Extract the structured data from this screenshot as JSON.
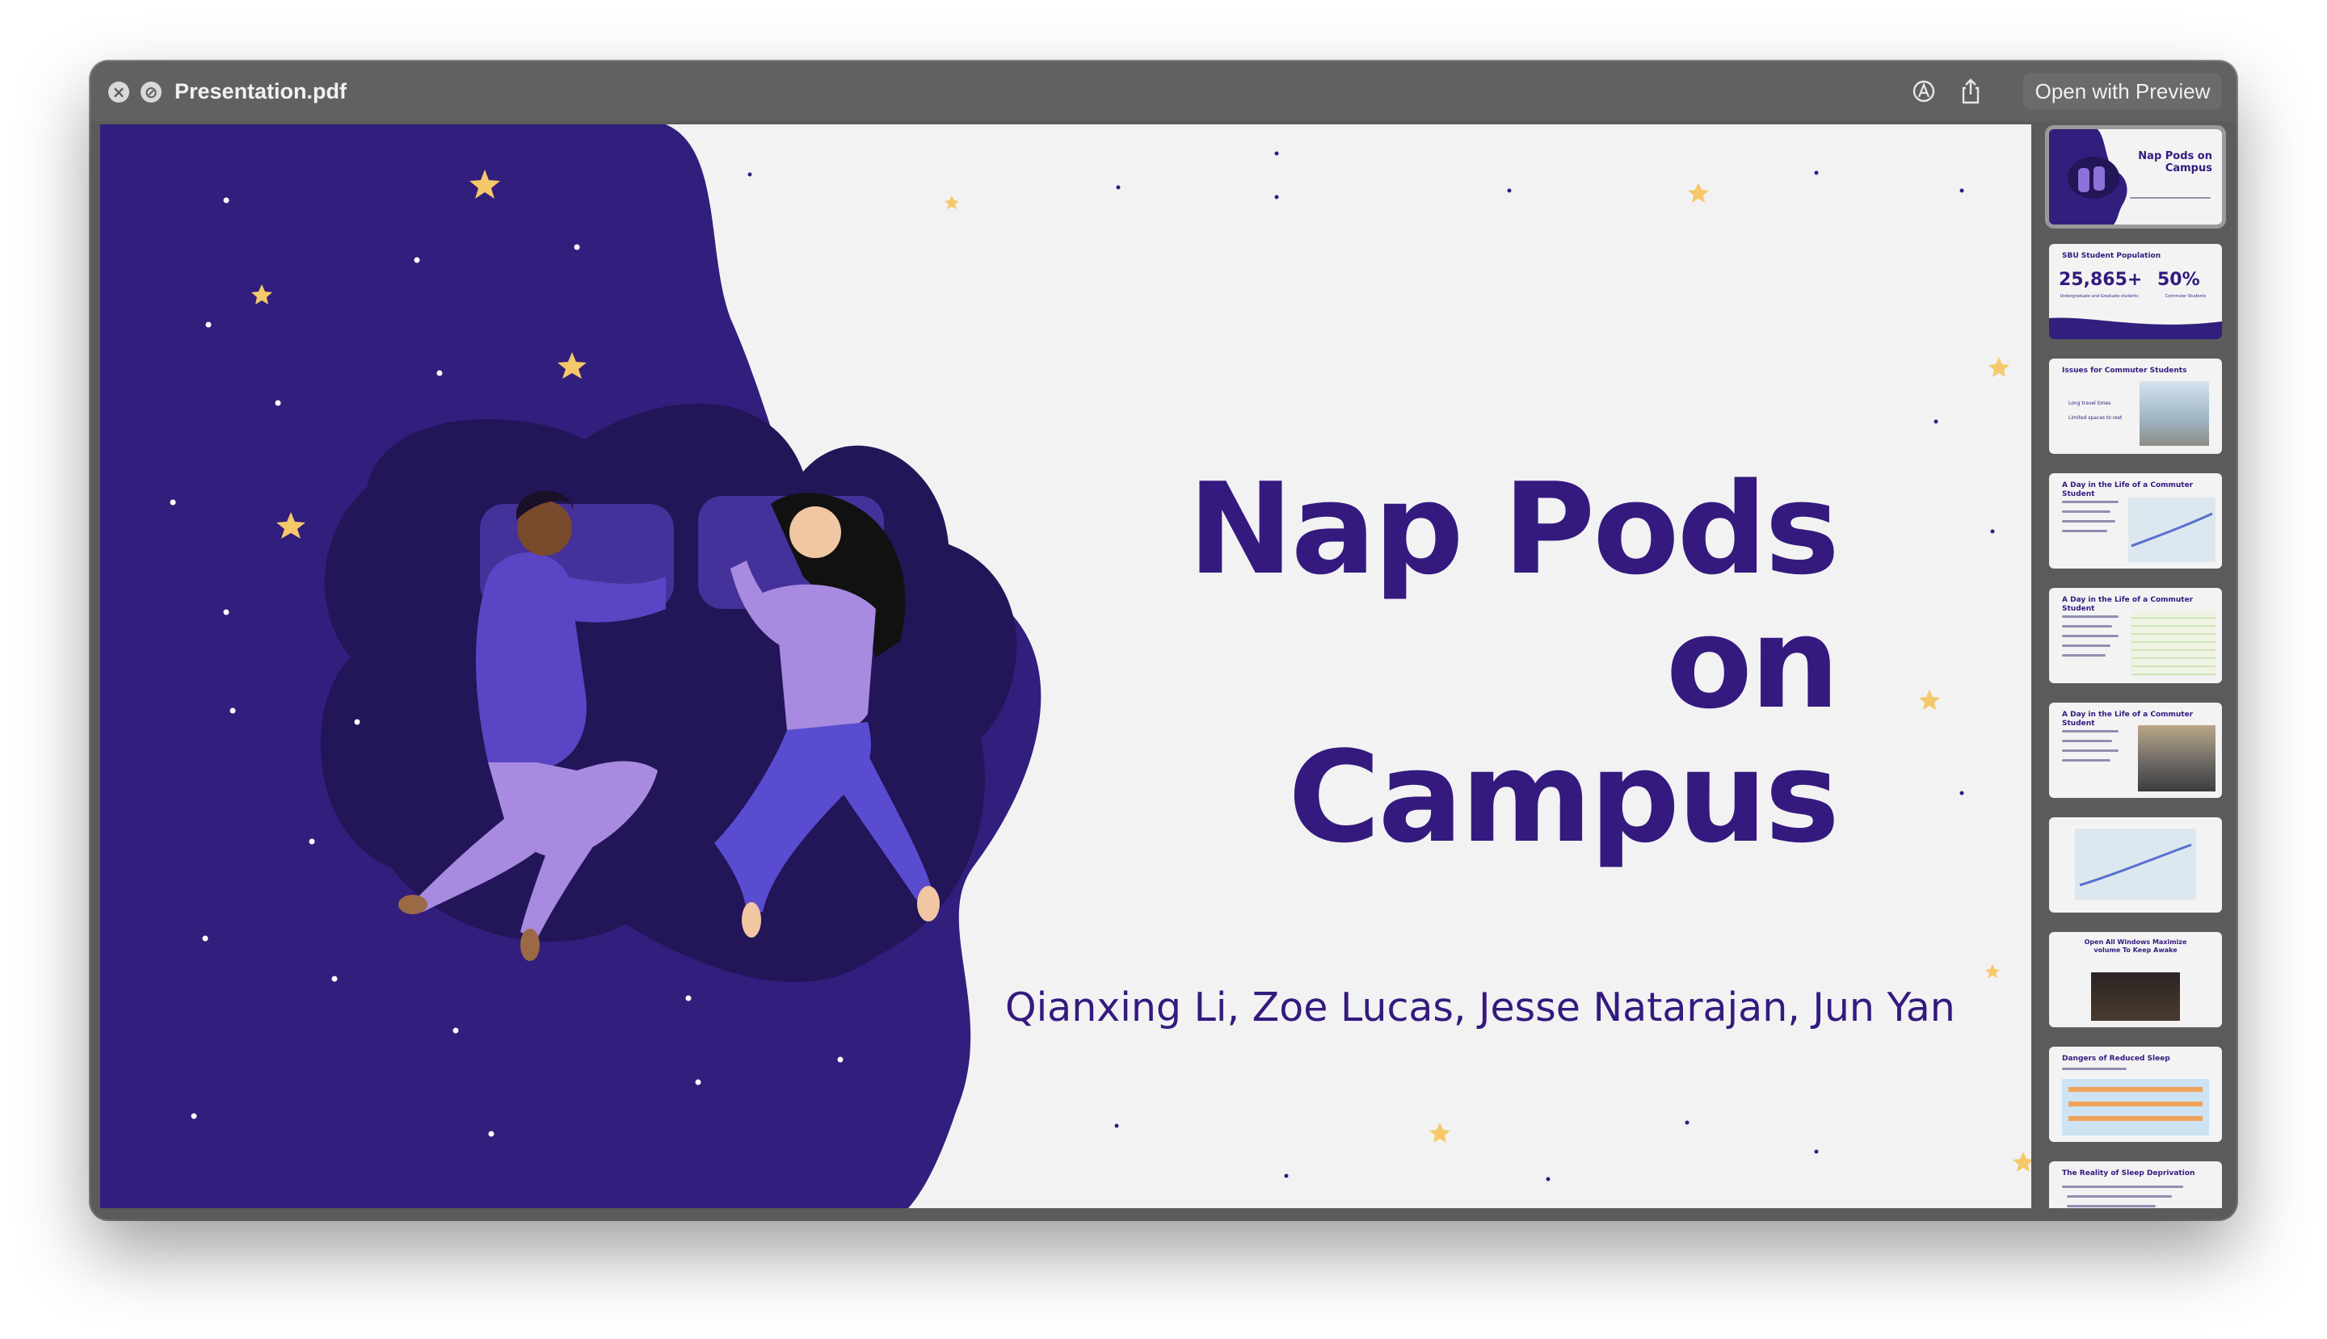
{
  "window": {
    "title": "Presentation.pdf",
    "open_with_label": "Open with Preview",
    "icons": [
      "close-icon",
      "block-icon",
      "markup-icon",
      "share-icon"
    ]
  },
  "slide": {
    "title": "Nap Pods on Campus",
    "authors": "Qianxing Li, Zoe Lucas, Jesse Natarajan, Jun Yan",
    "colors": {
      "background": "#f2f2f3",
      "purple_dark": "#321e7c",
      "purple_deep": "#221558",
      "title": "#341a7e",
      "star": "#f5c969"
    }
  },
  "thumbnails": [
    {
      "title": "Nap Pods on Campus",
      "selected": true
    },
    {
      "title": "SBU Student Population",
      "stat1": "25,865+",
      "stat1_label": "Undergraduate and Graduate students",
      "stat2": "50%",
      "stat2_label": "Commuter Students"
    },
    {
      "title": "Issues for Commuter Students",
      "bullets": [
        "Long travel times",
        "Limited spaces to rest"
      ]
    },
    {
      "title": "A Day in the Life of a Commuter Student"
    },
    {
      "title": "A Day in the Life of a Commuter Student"
    },
    {
      "title": "A Day in the Life of a Commuter Student"
    },
    {
      "title": ""
    },
    {
      "title": "Open All Windows Maximize volume To Keep Awake"
    },
    {
      "title": "Dangers of Reduced Sleep"
    },
    {
      "title": "The Reality of Sleep Deprivation"
    }
  ]
}
